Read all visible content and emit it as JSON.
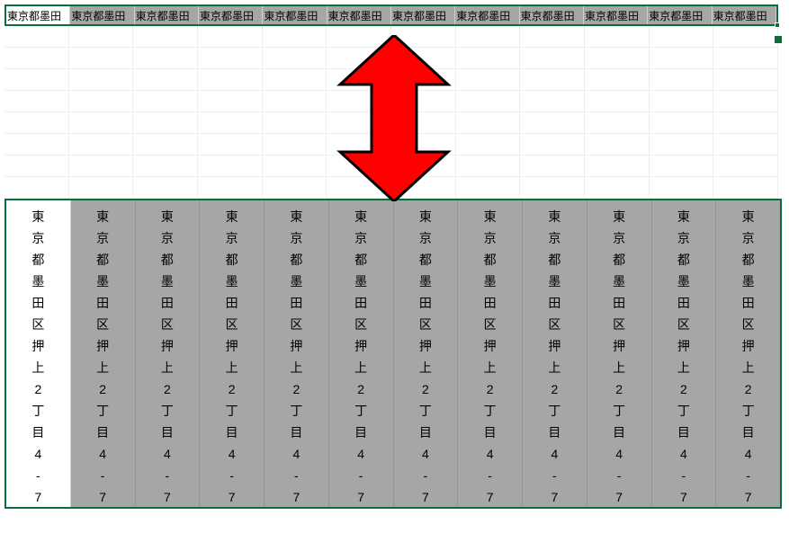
{
  "address_text": "東京都墨田区押上2丁目4-7",
  "truncated_label": "東京都墨田",
  "column_count": 12,
  "light_row_count": 8,
  "arrow": {
    "direction": "up-down",
    "color": "#ff0000",
    "stroke": "#000000"
  }
}
